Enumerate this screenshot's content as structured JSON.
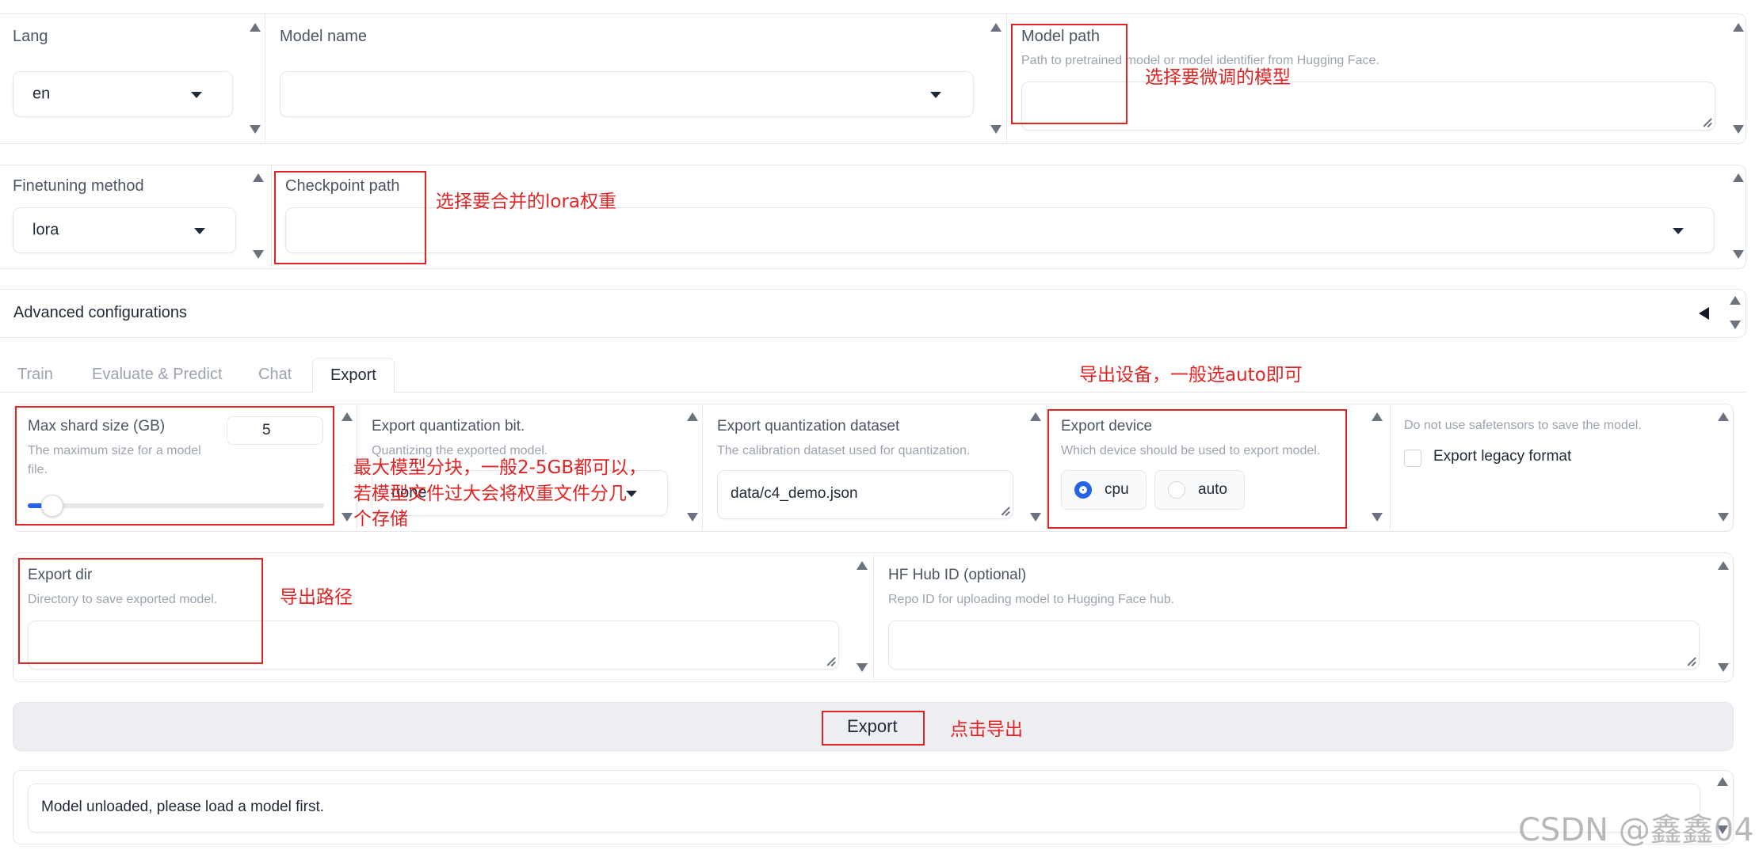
{
  "top": {
    "lang": {
      "label": "Lang",
      "value": "en"
    },
    "model_name": {
      "label": "Model name",
      "value": ""
    },
    "model_path": {
      "label": "Model path",
      "info": "Path to pretrained model or model identifier from Hugging Face.",
      "value": ""
    }
  },
  "row2": {
    "finetuning": {
      "label": "Finetuning method",
      "value": "lora"
    },
    "checkpoint": {
      "label": "Checkpoint path",
      "value": ""
    }
  },
  "advanced": {
    "label": "Advanced configurations"
  },
  "tabs": [
    {
      "label": "Train",
      "active": false
    },
    {
      "label": "Evaluate & Predict",
      "active": false
    },
    {
      "label": "Chat",
      "active": false
    },
    {
      "label": "Export",
      "active": true
    }
  ],
  "export": {
    "shard": {
      "label": "Max shard size (GB)",
      "info": "The maximum size for a model file.",
      "value": "5",
      "slider_fraction": 0.04
    },
    "quant_bit": {
      "label": "Export quantization bit.",
      "info": "Quantizing the exported model.",
      "value": "none"
    },
    "quant_dataset": {
      "label": "Export quantization dataset",
      "info": "The calibration dataset used for quantization.",
      "value": "data/c4_demo.json"
    },
    "device": {
      "label": "Export device",
      "info": "Which device should be used to export model.",
      "options": [
        "cpu",
        "auto"
      ],
      "selected": "cpu"
    },
    "legacy": {
      "info": "Do not use safetensors to save the model.",
      "label": "Export legacy format",
      "checked": false
    },
    "dir": {
      "label": "Export dir",
      "info": "Directory to save exported model.",
      "value": ""
    },
    "hub": {
      "label": "HF Hub ID (optional)",
      "info": "Repo ID for uploading model to Hugging Face hub.",
      "value": ""
    },
    "button": "Export",
    "output": "Model unloaded, please load a model first."
  },
  "annotations": {
    "model_path": "选择要微调的模型",
    "checkpoint": "选择要合并的lora权重",
    "device": "导出设备，一般选auto即可",
    "shard_line1": "最大模型分块，一般2-5GB都可以，",
    "shard_line2": "若模型文件过大会将权重文件分几",
    "shard_line3": "个存储",
    "dir": "导出路径",
    "button": "点击导出"
  },
  "watermark": "CSDN @鑫鑫04",
  "colors": {
    "annotation": "#e02424",
    "radio_selected": "#2563eb",
    "button_bg": "#eceef2"
  }
}
